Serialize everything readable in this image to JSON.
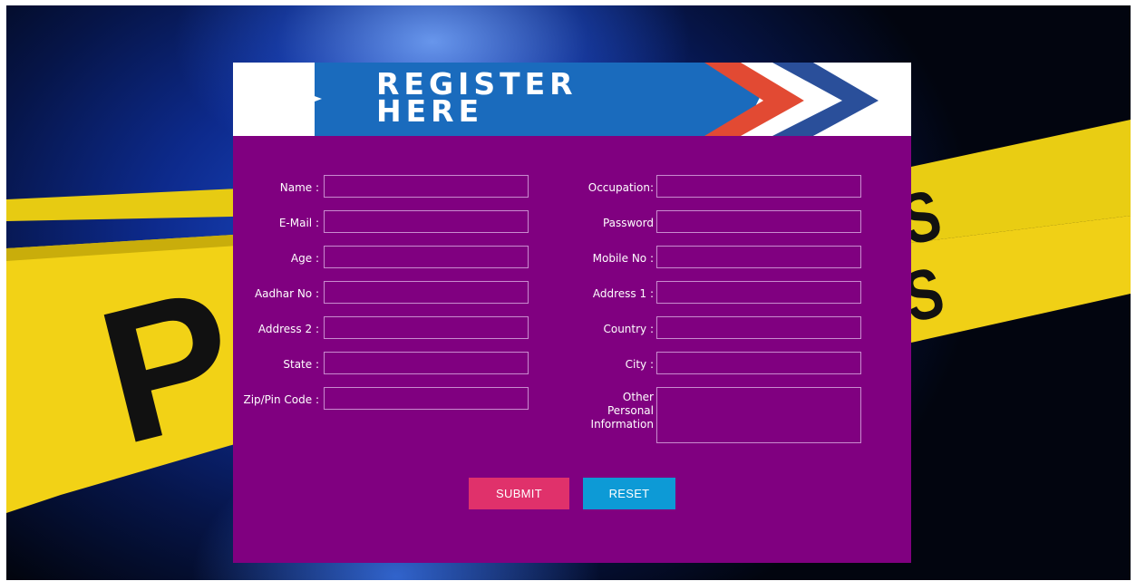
{
  "banner": {
    "line1": "REGISTER",
    "line2": "HERE"
  },
  "background": {
    "tape_text_left": "P",
    "tape_text_right_1": "CROSS",
    "tape_text_right_2": "CROSS"
  },
  "colors": {
    "card": "#800080",
    "banner_blue": "#1a6bbd",
    "submit": "#e0316b",
    "reset": "#0d9ad6",
    "tape_yellow": "#f2d216"
  },
  "form": {
    "left": [
      {
        "label": "Name :",
        "value": ""
      },
      {
        "label": "E-Mail :",
        "value": ""
      },
      {
        "label": "Age :",
        "value": ""
      },
      {
        "label": "Aadhar No :",
        "value": ""
      },
      {
        "label": "Address 2 :",
        "value": ""
      },
      {
        "label": "State :",
        "value": ""
      },
      {
        "label": "Zip/Pin Code :",
        "value": ""
      }
    ],
    "right": [
      {
        "label": "Occupation:",
        "value": ""
      },
      {
        "label": "Password",
        "value": ""
      },
      {
        "label": "Mobile No :",
        "value": ""
      },
      {
        "label": "Address 1 :",
        "value": ""
      },
      {
        "label": "Country :",
        "value": ""
      },
      {
        "label": "City :",
        "value": ""
      }
    ],
    "other": {
      "label_line1": "Other",
      "label_line2": "Personal",
      "label_line3": "Information",
      "value": ""
    }
  },
  "buttons": {
    "submit": "SUBMIT",
    "reset": "RESET"
  }
}
